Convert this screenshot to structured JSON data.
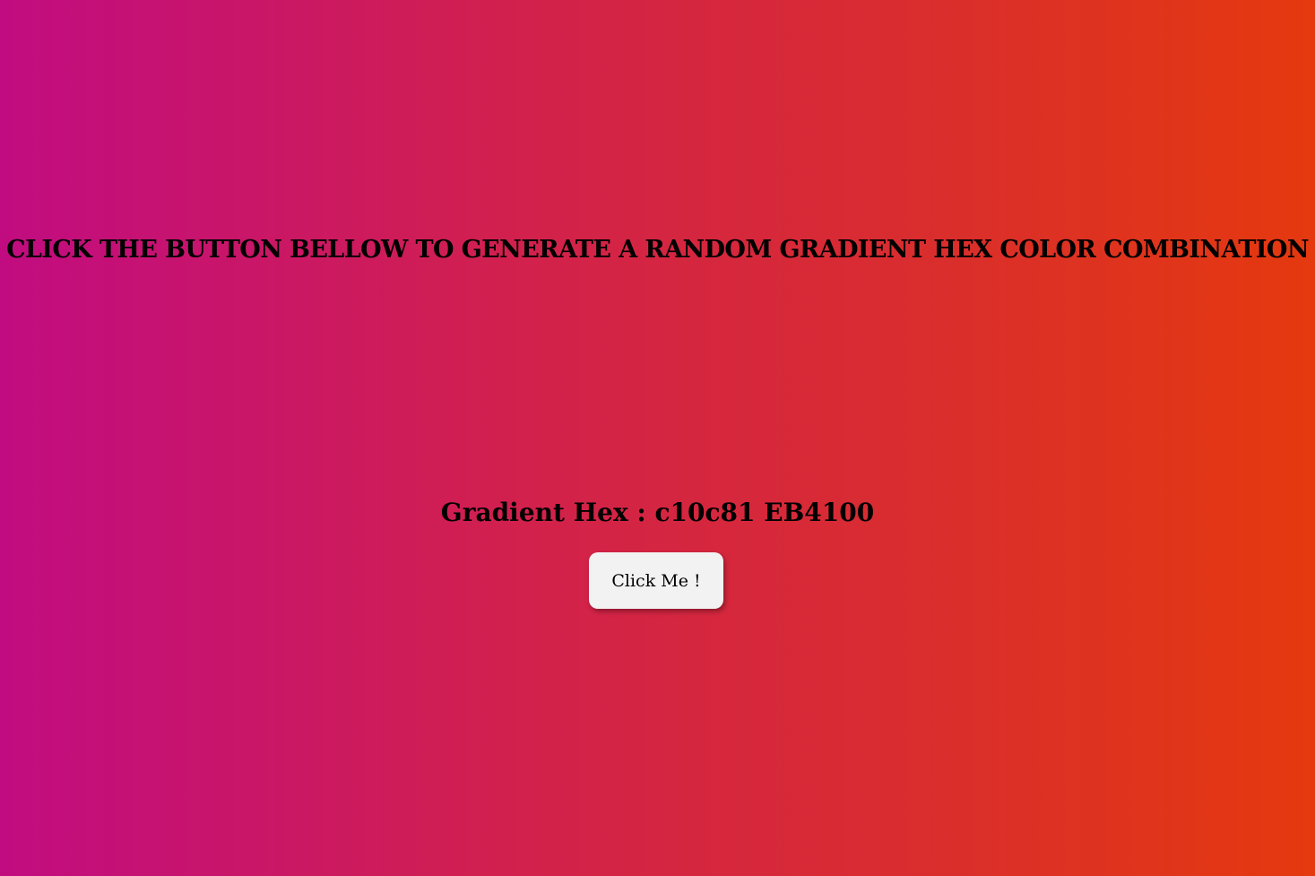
{
  "headline": "CLICK THE BUTTON BELLOW TO GENERATE A RANDOM GRADIENT HEX COLOR COMBINATION",
  "gradient": {
    "label": "Gradient Hex :",
    "color_start": "c10c81",
    "color_end": "EB4100"
  },
  "button": {
    "label": "Click Me !"
  },
  "colors": {
    "gradient_start": "#c10c81",
    "gradient_end": "#e5390f",
    "button_bg": "#f2f2f2",
    "text": "#000000"
  }
}
